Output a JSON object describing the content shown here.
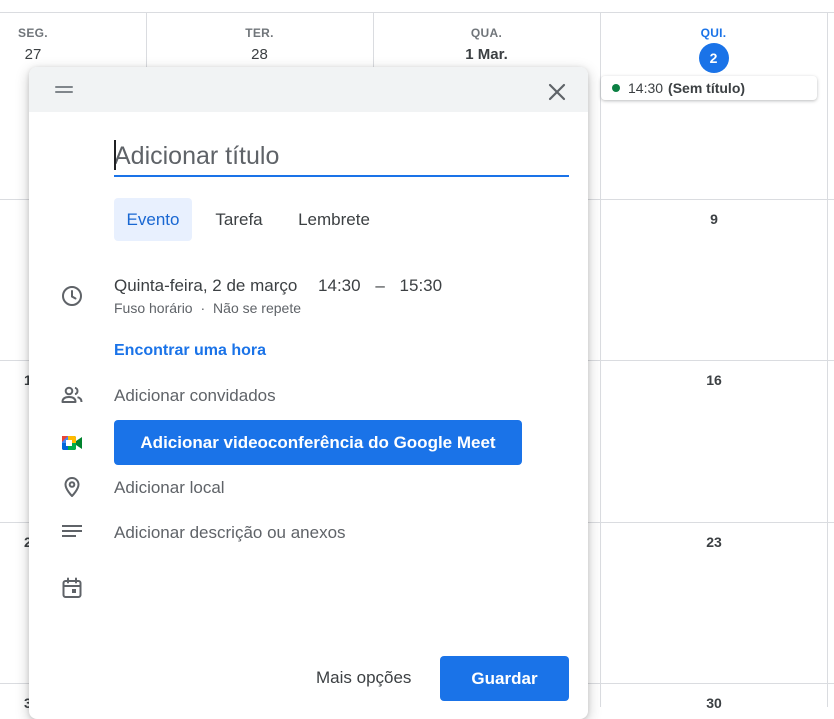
{
  "calendar": {
    "days": [
      {
        "dow": "SEG.",
        "num": "27"
      },
      {
        "dow": "TER.",
        "num": "28"
      },
      {
        "dow": "QUA.",
        "num": "1 Mar."
      },
      {
        "dow": "QUI.",
        "num": "2"
      }
    ],
    "weeks": [
      "9",
      "16",
      "23",
      "30"
    ],
    "partial_left": [
      "1",
      "2",
      "3"
    ],
    "event": {
      "time": "14:30",
      "title": "(Sem título)"
    },
    "colors": {
      "accent": "#1a73e8",
      "event_dot": "#0b8043"
    }
  },
  "dialog": {
    "title_placeholder": "Adicionar título",
    "tabs": [
      "Evento",
      "Tarefa",
      "Lembrete"
    ],
    "active_tab": "Evento",
    "date": "Quinta-feira, 2 de março",
    "start_time": "14:30",
    "separator": "–",
    "end_time": "15:30",
    "timezone": "Fuso horário",
    "dot": "·",
    "recurrence": "Não se repete",
    "find_time": "Encontrar uma hora",
    "add_guests": "Adicionar convidados",
    "meet_button": "Adicionar videoconferência do Google Meet",
    "add_location": "Adicionar local",
    "add_description": "Adicionar descrição ou anexos",
    "more_options": "Mais opções",
    "save": "Guardar",
    "icons": [
      "drag-handle-icon",
      "close-icon",
      "clock-icon",
      "people-icon",
      "google-meet-icon",
      "location-pin-icon",
      "description-icon",
      "calendar-icon"
    ]
  }
}
